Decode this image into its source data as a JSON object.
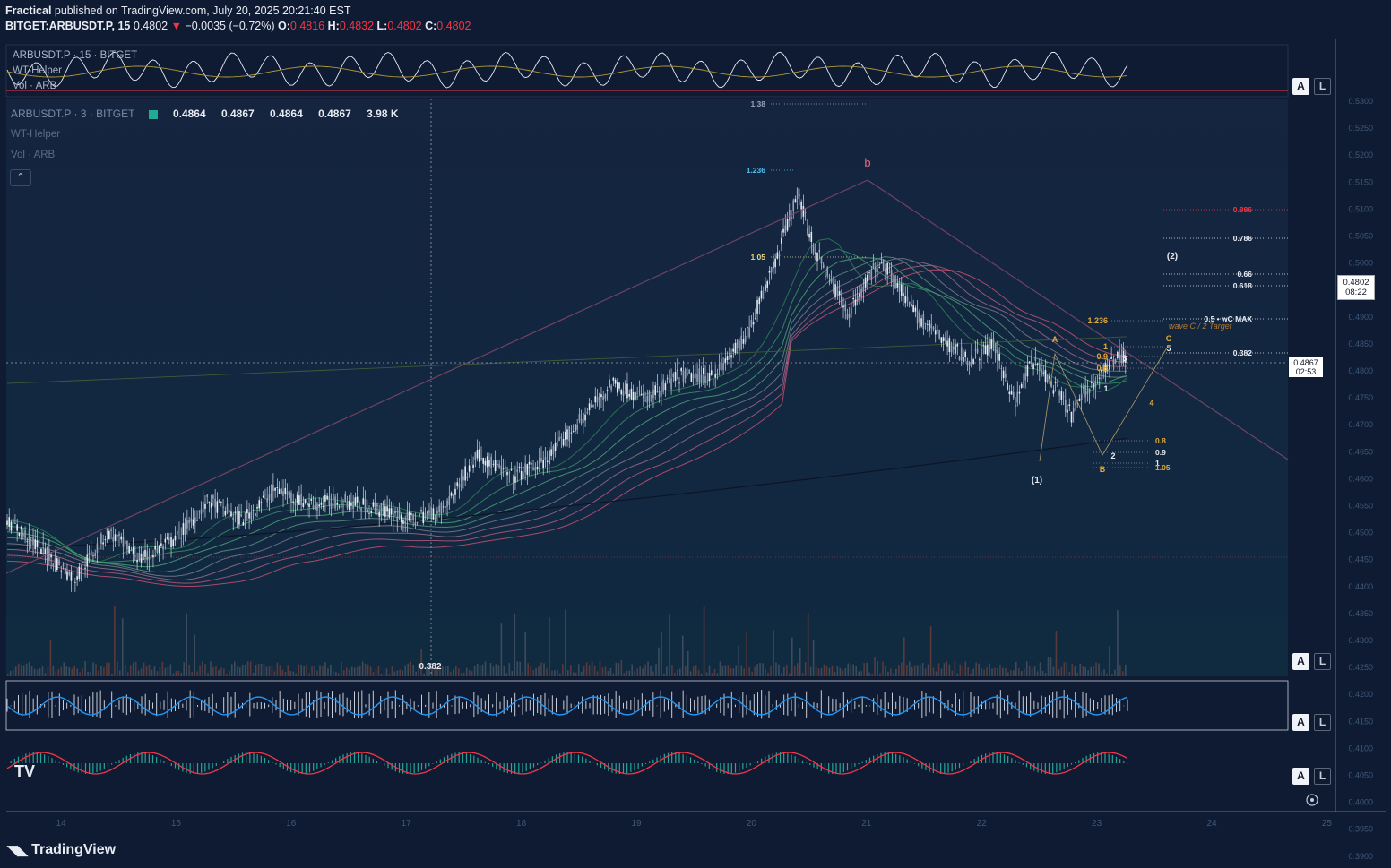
{
  "header": {
    "author": "Fractical",
    "published_text": "published on TradingView.com, July 20, 2025 20:21:40 EST",
    "symbol": "BITGET:ARBUSDT.P, 15",
    "last": "0.4802",
    "change": "−0.0035 (−0.72%)",
    "o_label": "O:",
    "o": "0.4816",
    "h_label": "H:",
    "h": "0.4832",
    "l_label": "L:",
    "l": "0.4802",
    "c_label": "C:",
    "c": "0.4802"
  },
  "top_pane_legend": {
    "symbol": "ARBUSDT.P · 15 · BITGET",
    "line2": "WT-Helper",
    "line3": "Vol · ARB"
  },
  "main_legend": {
    "symbol": "ARBUSDT.P · 3 · BITGET",
    "o": "0.4864",
    "h": "0.4867",
    "l": "0.4864",
    "c": "0.4867",
    "vol": "3.98 K",
    "line2": "WT-Helper",
    "line3": "Vol · ARB"
  },
  "price_tags": {
    "outer_price": "0.4802",
    "outer_time": "08:22",
    "inner_price": "0.4867",
    "inner_time": "02:53"
  },
  "axis_buttons": {
    "a": "A",
    "l": "L"
  },
  "fib_labels": {
    "f1_38": "1.38",
    "f1_236": "1.236",
    "f1_05": "1.05",
    "wave_b": "b",
    "r0886": "0.886",
    "r0786": "0.786",
    "r066": "0.66",
    "r0618": "0.618",
    "r05": "0.5 • wC MAX",
    "r0382": "0.382",
    "wave2": "(2)",
    "wave1": "(1)",
    "target": "wave C / 2 Target",
    "o1236": "1.236",
    "o1": "1",
    "o09": "0.9",
    "o08": "0.8",
    "l08": "0.8",
    "l09": "0.9",
    "l1": "1",
    "l105": "1.05",
    "wA": "A",
    "wB": "B",
    "wC": "C",
    "w1": "1",
    "w2": "2",
    "w3": "3",
    "w4": "4",
    "w5": "5",
    "bottom382": "0.382"
  },
  "price_axis_inner": [
    "0.5300",
    "0.5250",
    "0.5200",
    "0.5150",
    "0.5100",
    "0.5050",
    "0.5000",
    "0.4950",
    "0.4900",
    "0.4850",
    "0.4800",
    "0.4750",
    "0.4700",
    "0.4650",
    "0.4600",
    "0.4550",
    "0.4500",
    "0.4450",
    "0.4400",
    "0.4350",
    "0.4300",
    "0.4250",
    "0.4200",
    "0.4150",
    "0.4100",
    "0.4050",
    "0.4000",
    "0.3950",
    "0.3900",
    "0.3850"
  ],
  "time_axis": [
    "14",
    "15",
    "16",
    "17",
    "18",
    "19",
    "20",
    "21",
    "22",
    "23",
    "24",
    "25"
  ],
  "footer": {
    "brand": "TradingView"
  },
  "colors": {
    "background": "#0f1b33",
    "frame": "#2a8c9a",
    "up": "#22ab94",
    "down": "#f23645",
    "candle": "#d1d4dc",
    "fib_gold": "#e0a93a",
    "fib_red": "#f23645",
    "fib_cyan": "#4fc3f7"
  },
  "chart_data": {
    "type": "candlestick",
    "title": "",
    "xlabel": "",
    "ylabel": "",
    "ylim": [
      0.385,
      0.533
    ],
    "x_days": [
      "14",
      "15",
      "16",
      "17",
      "18",
      "19",
      "20",
      "21",
      "22",
      "23"
    ],
    "close_path": [
      [
        0.0,
        0.425
      ],
      [
        0.03,
        0.418
      ],
      [
        0.06,
        0.41
      ],
      [
        0.09,
        0.422
      ],
      [
        0.12,
        0.415
      ],
      [
        0.15,
        0.42
      ],
      [
        0.18,
        0.43
      ],
      [
        0.21,
        0.425
      ],
      [
        0.24,
        0.433
      ],
      [
        0.27,
        0.429
      ],
      [
        0.3,
        0.43
      ],
      [
        0.33,
        0.428
      ],
      [
        0.36,
        0.425
      ],
      [
        0.39,
        0.428
      ],
      [
        0.42,
        0.442
      ],
      [
        0.45,
        0.436
      ],
      [
        0.48,
        0.44
      ],
      [
        0.51,
        0.45
      ],
      [
        0.54,
        0.46
      ],
      [
        0.57,
        0.456
      ],
      [
        0.6,
        0.462
      ],
      [
        0.63,
        0.462
      ],
      [
        0.66,
        0.472
      ],
      [
        0.69,
        0.495
      ],
      [
        0.705,
        0.509
      ],
      [
        0.72,
        0.495
      ],
      [
        0.75,
        0.478
      ],
      [
        0.78,
        0.492
      ],
      [
        0.81,
        0.478
      ],
      [
        0.84,
        0.47
      ],
      [
        0.86,
        0.466
      ],
      [
        0.88,
        0.47
      ],
      [
        0.9,
        0.455
      ],
      [
        0.915,
        0.466
      ],
      [
        0.93,
        0.461
      ],
      [
        0.95,
        0.452
      ],
      [
        0.96,
        0.457
      ],
      [
        0.975,
        0.462
      ],
      [
        0.99,
        0.467
      ]
    ],
    "fib_levels": [
      {
        "label": "0.886",
        "value": 0.519
      },
      {
        "label": "0.786",
        "value": 0.5135
      },
      {
        "label": "0.66",
        "value": 0.508
      },
      {
        "label": "0.618",
        "value": 0.506
      },
      {
        "label": "0.5 • wC MAX",
        "value": 0.499
      },
      {
        "label": "0.382",
        "value": 0.493
      },
      {
        "label": "1.38",
        "value": 0.53
      },
      {
        "label": "1.236",
        "value": 0.517
      },
      {
        "label": "1.05",
        "value": 0.504
      }
    ],
    "last_price": 0.4802
  }
}
